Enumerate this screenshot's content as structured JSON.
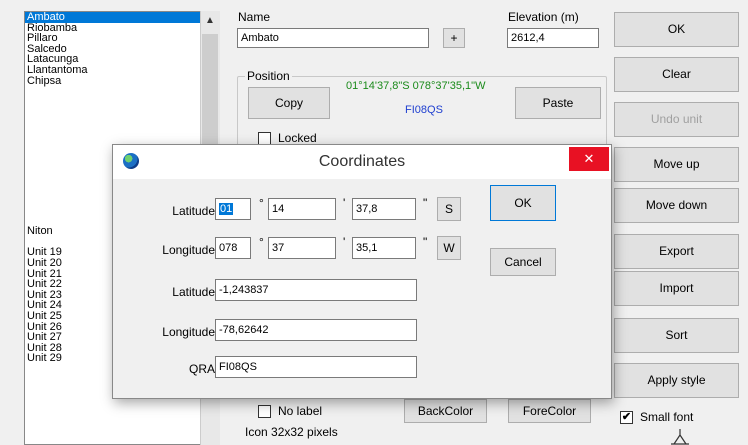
{
  "locations": {
    "items": [
      "Ambato",
      "Riobamba",
      "Pillaro",
      "Salcedo",
      "Latacunga",
      "Llantantoma",
      "Chipsa"
    ],
    "selected": "Ambato",
    "lower_items": [
      "Niton",
      "",
      "Unit  19",
      "Unit  20",
      "Unit  21",
      "Unit  22",
      "Unit  23",
      "Unit  24",
      "Unit  25",
      "Unit  26",
      "Unit  27",
      "Unit  28",
      "Unit  29"
    ]
  },
  "form": {
    "name_label": "Name",
    "name_value": "Ambato",
    "plus_label": "+",
    "elevation_label": "Elevation (m)",
    "elevation_value": "2612,4",
    "position_label": "Position",
    "position_coords": "01°14'37,8\"S 078°37'35,1\"W",
    "position_qra": "FI08QS",
    "copy_label": "Copy",
    "paste_label": "Paste",
    "locked_label": "Locked",
    "no_label_label": "No label",
    "backcolor_label": "BackColor",
    "forecolor_label": "ForeColor",
    "icon_size_label": "Icon 32x32 pixels",
    "small_font_label": "Small font",
    "small_font_checked": "✔"
  },
  "right_buttons": {
    "ok": "OK",
    "clear": "Clear",
    "undo_unit": "Undo unit",
    "move_up": "Move up",
    "move_down": "Move down",
    "export": "Export",
    "import": "Import",
    "sort": "Sort",
    "apply_style": "Apply style"
  },
  "dialog": {
    "title": "Coordinates",
    "close": "✕",
    "lat_label": "Latitude",
    "lat_deg": "01",
    "lat_min": "14",
    "lat_sec": "37,8",
    "lat_hemi": "S",
    "lon_label": "Longitude",
    "lon_deg": "078",
    "lon_min": "37",
    "lon_sec": "35,1",
    "lon_hemi": "W",
    "deg_symbol": "°",
    "min_symbol": "'",
    "sec_symbol": "\"",
    "lat_decimal_label": "Latitude",
    "lat_decimal": "-1,243837",
    "lon_decimal_label": "Longitude",
    "lon_decimal": "-78,62642",
    "qra_label": "QRA",
    "qra_value": "FI08QS",
    "ok_label": "OK",
    "cancel_label": "Cancel"
  },
  "colors": {
    "selection": "#0078d7",
    "coords_text": "#1a8a1a",
    "qra_text": "#1f3fd0",
    "close_button": "#e81123"
  }
}
